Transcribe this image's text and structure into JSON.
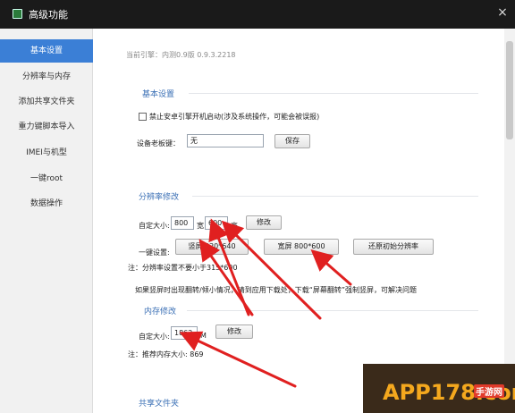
{
  "window": {
    "title": "高级功能",
    "close_icon": "×"
  },
  "sidebar": {
    "items": [
      {
        "label": "基本设置",
        "active": true
      },
      {
        "label": "分辨率与内存"
      },
      {
        "label": "添加共享文件夹"
      },
      {
        "label": "重力键脚本导入"
      },
      {
        "label": "IMEI与机型"
      },
      {
        "label": "一键root"
      },
      {
        "label": "数据操作"
      }
    ]
  },
  "engine_info": "当前引擎：内测0.9版 0.9.3.2218",
  "basic": {
    "title": "基本设置",
    "checkbox_label": "禁止安卓引擎开机启动(涉及系统操作，可能会被误报)",
    "board_label": "设备老板键：",
    "board_value": "无",
    "save_label": "保存"
  },
  "resolution": {
    "title": "分辨率修改",
    "custom_label": "自定大小:",
    "width_value": "800",
    "width_unit": "宽",
    "height_value": "600",
    "height_unit": "高",
    "modify_label": "修改",
    "onekey_label": "一键设置:",
    "portrait_label": "竖屏  320*640",
    "landscape_label": "宽屏  800*600",
    "restore_label": "还原初始分辨率",
    "note": "注：分辨率设置不要小于315*600",
    "tip": "如果竖屏时出现翻转/倾小情况，请到应用下载处，下载“屏幕翻转”强制竖屏，可解决问题"
  },
  "memory": {
    "title": "内存修改",
    "custom_label": "自定大小:",
    "value": "1862",
    "unit": "M",
    "modify_label": "修改",
    "note": "注：推荐内存大小: 869"
  },
  "shared": {
    "title": "共享文件夹"
  },
  "watermark": {
    "text": "APP178.com",
    "sub": "手游网"
  },
  "colors": {
    "accent": "#3b7fd6",
    "section_title": "#3a6fb5",
    "titlebar": "#1a1a1a",
    "arrow": "#e02020"
  }
}
